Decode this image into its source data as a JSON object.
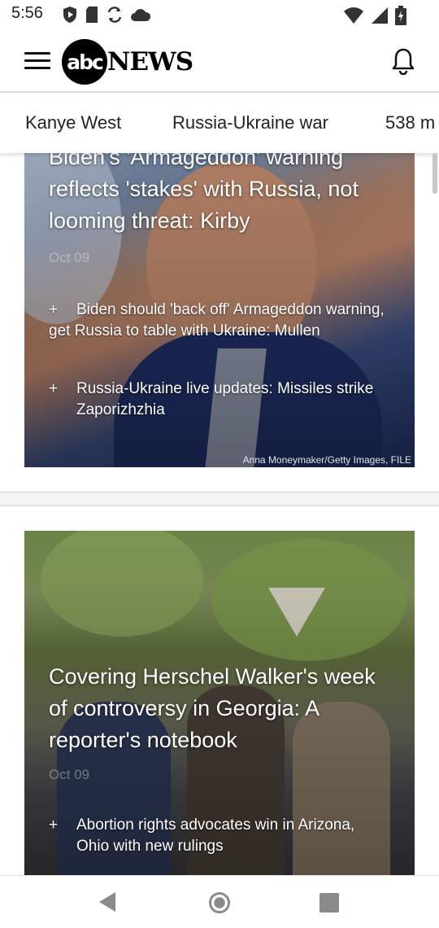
{
  "status_bar": {
    "time": "5:56",
    "left_icons": [
      "play-protect-icon",
      "sd-card-icon",
      "sync-icon",
      "cloud-icon"
    ],
    "right_icons": [
      "wifi-icon",
      "cell-signal-icon",
      "battery-icon"
    ]
  },
  "header": {
    "logo_abc": "abc",
    "logo_news": "NEWS",
    "menu_icon": "hamburger-menu-icon",
    "bell_icon": "notification-bell-icon"
  },
  "topics": [
    {
      "label": "Kanye West"
    },
    {
      "label": "Russia-Ukraine war"
    },
    {
      "label": "538 m"
    }
  ],
  "stories": [
    {
      "headline": "Biden's 'Armageddon' warning reflects 'stakes' with Russia, not looming threat: Kirby",
      "date": "Oct 09",
      "related": [
        "Biden should 'back off' Armageddon warning, get Russia to table with Ukraine: Mullen",
        "Russia-Ukraine live updates: Missiles strike Zaporizhzhia"
      ],
      "credit": "Anna Moneymaker/Getty Images, FILE"
    },
    {
      "headline": "Covering Herschel Walker's week of controversy in Georgia: A reporter's notebook",
      "date": "Oct 09",
      "related": [
        "Abortion rights advocates win in Arizona, Ohio with new rulings"
      ]
    }
  ],
  "nav_bar": {
    "back_icon": "back-triangle-icon",
    "home_icon": "home-circle-icon",
    "recents_icon": "recents-square-icon"
  }
}
